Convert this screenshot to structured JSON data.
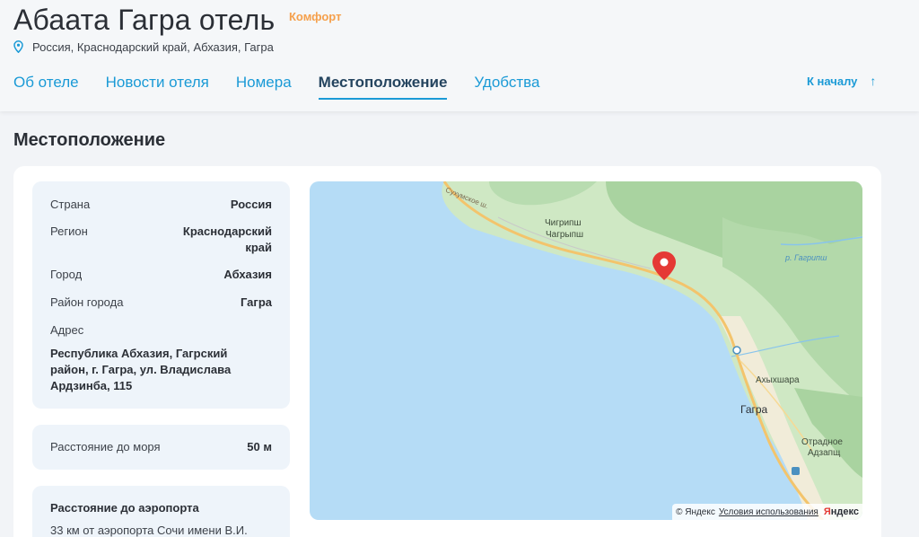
{
  "hotel": {
    "title": "Абаата Гагра отель",
    "category": "Комфорт",
    "address": "Россия, Краснодарский край, Абхазия, Гагра"
  },
  "tabs": [
    {
      "label": "Об отеле"
    },
    {
      "label": "Новости отеля"
    },
    {
      "label": "Номера"
    },
    {
      "label": "Местоположение",
      "active": true
    },
    {
      "label": "Удобства"
    }
  ],
  "to_top": {
    "label": "К началу",
    "icon": "arrow-up-icon"
  },
  "section": {
    "title": "Местоположение"
  },
  "location": {
    "country": {
      "label": "Страна",
      "value": "Россия"
    },
    "region": {
      "label": "Регион",
      "value": "Краснодарский край"
    },
    "city": {
      "label": "Город",
      "value": "Абхазия"
    },
    "district": {
      "label": "Район города",
      "value": "Гагра"
    },
    "address": {
      "label": "Адрес",
      "value": "Республика Абхазия, Гагрский район, г. Гагра, ул. Владислава Ардзинба, 115"
    }
  },
  "sea_distance": {
    "label": "Расстояние до моря",
    "value": "50 м"
  },
  "airport": {
    "title": "Расстояние до аэропорта",
    "text": "33 км от аэропорта Сочи имени В.И."
  },
  "map": {
    "places": {
      "chigripsh": "Чигрипш",
      "chagrypsh": "Чагрыпш",
      "akhykhshara": "Ахыхшара",
      "gagra": "Гагра",
      "otradnoe": "Отрадное",
      "adzapsh": "Адзапщ"
    },
    "river": "р. Гагрипш",
    "road": "Сухумское ш.",
    "copyright": "© Яндекс",
    "terms": "Условия использования",
    "brand_first": "Я",
    "brand_rest": "ндекс",
    "colors": {
      "sea": "#b5dcf6",
      "land": "#cfe8c4",
      "forest": "#a9d3a0",
      "road": "#f3c46c",
      "marker": "#e53935"
    }
  }
}
